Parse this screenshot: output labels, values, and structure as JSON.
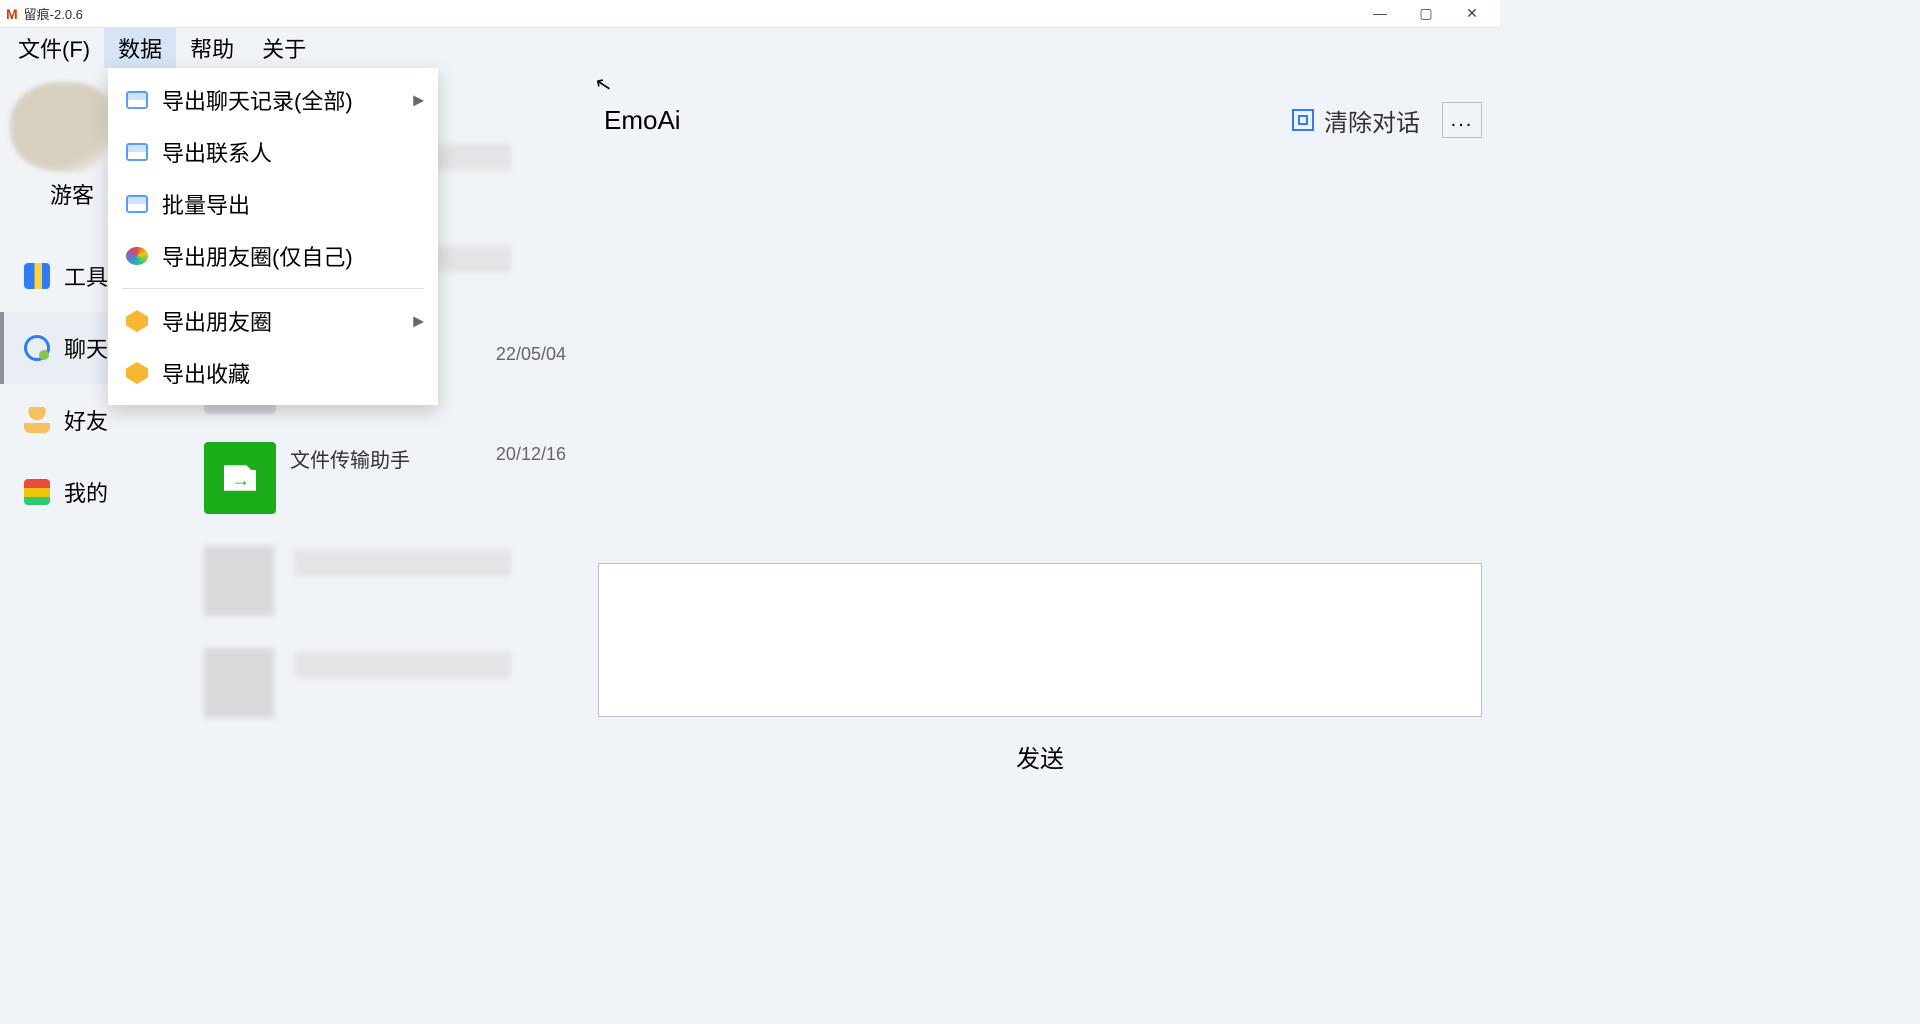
{
  "titlebar": {
    "app_icon": "M",
    "title": "留痕-2.0.6"
  },
  "menubar": {
    "items": [
      "文件(F)",
      "数据",
      "帮助",
      "关于"
    ],
    "active_index": 1
  },
  "dropdown": {
    "group1": [
      {
        "label": "导出聊天记录(全部)",
        "has_submenu": true,
        "icon": "folder"
      },
      {
        "label": "导出联系人",
        "has_submenu": false,
        "icon": "folder"
      },
      {
        "label": "批量导出",
        "has_submenu": false,
        "icon": "folder"
      },
      {
        "label": "导出朋友圈(仅自己)",
        "has_submenu": false,
        "icon": "colorful"
      }
    ],
    "group2": [
      {
        "label": "导出朋友圈",
        "has_submenu": true,
        "icon": "badge"
      },
      {
        "label": "导出收藏",
        "has_submenu": false,
        "icon": "badge"
      }
    ]
  },
  "sidebar": {
    "username": "游客",
    "nav": [
      {
        "key": "tools",
        "label": "工具"
      },
      {
        "key": "chat",
        "label": "聊天"
      },
      {
        "key": "friend",
        "label": "好友"
      },
      {
        "key": "mine",
        "label": "我的"
      }
    ],
    "selected_key": "chat"
  },
  "chatlist": {
    "rows": [
      {
        "kind": "blur"
      },
      {
        "kind": "blur"
      },
      {
        "kind": "chat",
        "name": "",
        "date": "22/05/04"
      },
      {
        "kind": "file",
        "name": "文件传输助手",
        "date": "20/12/16"
      },
      {
        "kind": "blur"
      },
      {
        "kind": "blur"
      }
    ]
  },
  "conversation": {
    "title": "EmoAi",
    "clear_label": "清除对话",
    "more_label": "...",
    "send_label": "发送"
  }
}
